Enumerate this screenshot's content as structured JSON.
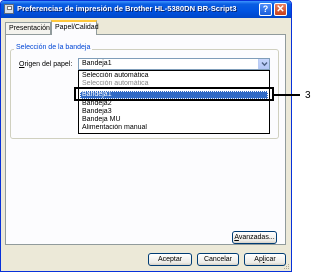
{
  "window": {
    "title": "Preferencias de impresión de Brother HL-5380DN BR-Script3",
    "help_button": "?",
    "close_button": "✕"
  },
  "tabs": [
    {
      "label": "Presentación",
      "active": false
    },
    {
      "label": "Papel/Calidad",
      "active": true
    }
  ],
  "tray_group": {
    "label": "Selección de la bandeja",
    "field_label_accel": "O",
    "field_label_rest": "rigen del papel:",
    "combo_value": "Bandeja1",
    "options": [
      "Selección automática",
      "Bandeja1",
      "Bandeja2",
      "Bandeja3",
      "Bandeja MU",
      "Alimentación manual"
    ],
    "selected_index": 1,
    "overlap_text": "Selección automática"
  },
  "callout": {
    "number": "3"
  },
  "buttons": {
    "advanced_accel": "A",
    "advanced_rest": "vanzadas...",
    "ok": "Aceptar",
    "cancel": "Cancelar",
    "apply_accel": "l",
    "apply_pre": "Ap",
    "apply_post": "icar"
  },
  "colors": {
    "title_bar": "#0053e1",
    "selection": "#316ac5",
    "group_label": "#0046d5"
  }
}
